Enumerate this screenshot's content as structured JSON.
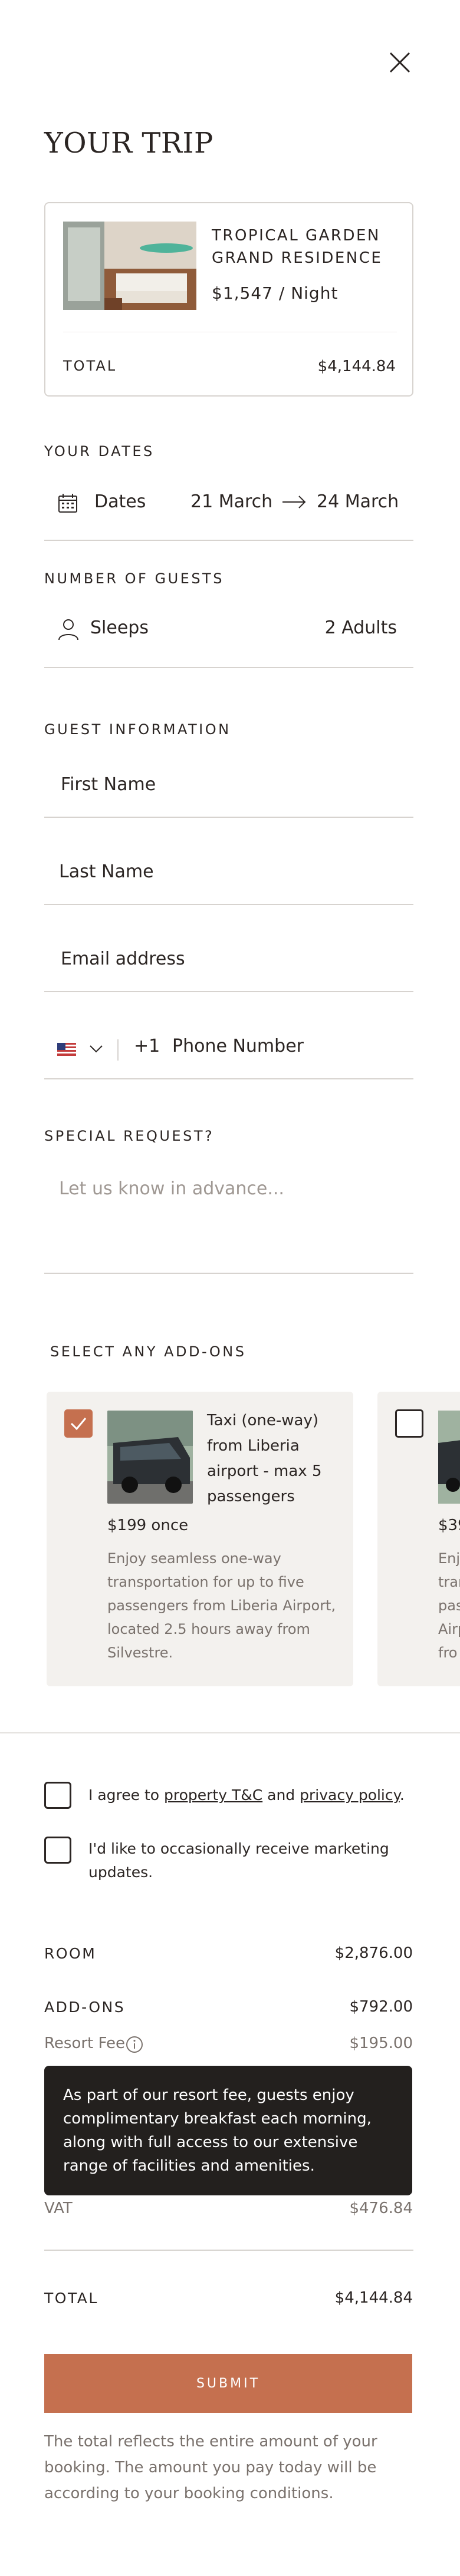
{
  "header": {
    "title": "YOUR TRIP",
    "close_icon": "close-icon"
  },
  "trip_card": {
    "hotel_name": "TROPICAL GARDEN GRAND RESIDENCE",
    "price": "$1,547 / Night",
    "total_label": "TOTAL",
    "total_value": "$4,144.84"
  },
  "dates": {
    "section_label": "YOUR DATES",
    "icon": "calendar-icon",
    "label": "Dates",
    "start": "21 March",
    "arrow_icon": "arrow-right-icon",
    "end": "24 March"
  },
  "guests": {
    "section_label": "NUMBER OF GUESTS",
    "icon": "person-icon",
    "label": "Sleeps",
    "value": "2 Adults"
  },
  "guest_info": {
    "section_label": "GUEST INFORMATION",
    "first_name_placeholder": "First Name",
    "last_name_placeholder": "Last Name",
    "email_placeholder": "Email address",
    "country_flag_icon": "us-flag-icon",
    "dial_code": "+1",
    "phone_placeholder": "Phone Number"
  },
  "special_request": {
    "section_label": "SPECIAL REQUEST?",
    "placeholder": "Let us know in advance..."
  },
  "addons": {
    "section_label": "SELECT ANY ADD-ONS",
    "items": [
      {
        "title": "Taxi (one-way) from Liberia airport - max 5 passengers",
        "price": "$199 once",
        "description": "Enjoy seamless one-way transportation for up to five passengers from Liberia Airport, located 2.5 hours away from Silvestre.",
        "checked": true
      },
      {
        "title": "",
        "price": "$39",
        "description": "Enj tran pas Airp fro",
        "checked": false
      }
    ]
  },
  "consent": {
    "terms_prefix": "I agree to ",
    "terms_link": "property T&C",
    "terms_and": " and ",
    "privacy_link": "privacy policy",
    "terms_suffix": ".",
    "marketing": "I'd like to occasionally receive marketing updates."
  },
  "summary": {
    "room_label": "ROOM",
    "room_value": "$2,876.00",
    "addons_label": "ADD-ONS",
    "addons_value": "$792.00",
    "resort_fee_label": "Resort Fee",
    "resort_fee_value": "$195.00",
    "tooltip": "As part of our resort fee, guests enjoy complimentary breakfast each morning, along with full access to our extensive range of facilities and amenities.",
    "vat_label": "VAT",
    "vat_value": "$476.84",
    "total_label": "TOTAL",
    "total_value": "$4,144.84"
  },
  "submit_label": "SUBMIT",
  "footer_note": "The total reflects the entire amount of your booking. The amount you pay today will be according to your booking conditions.",
  "colors": {
    "accent": "#c5704f",
    "text": "#2b2523",
    "muted": "#7a726d",
    "line": "#d7d3cf",
    "card_bg": "#f3f1ee",
    "tooltip_bg": "#23201e"
  }
}
